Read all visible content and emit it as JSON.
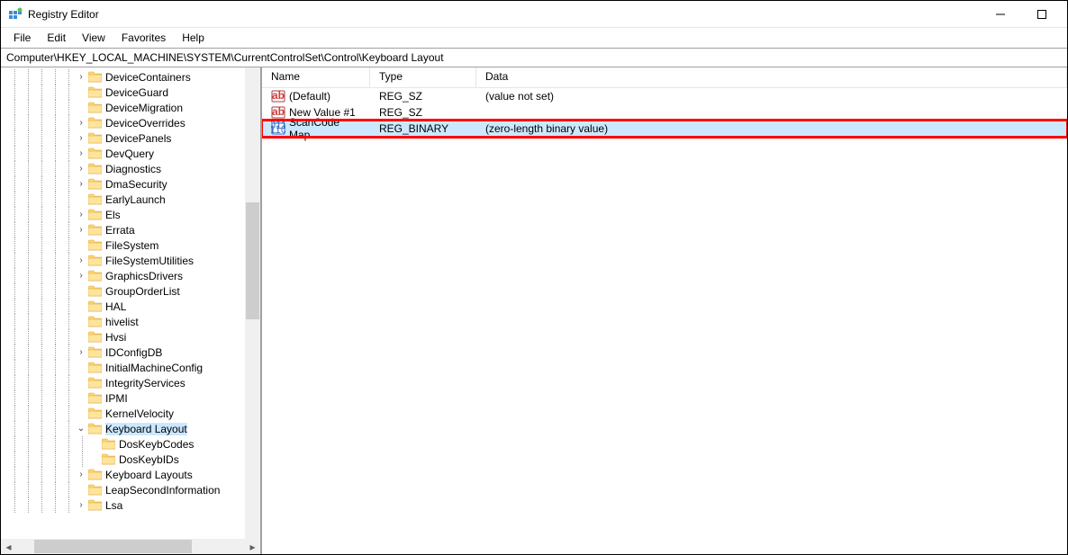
{
  "window": {
    "title": "Registry Editor"
  },
  "menubar": {
    "file": "File",
    "edit": "Edit",
    "view": "View",
    "favorites": "Favorites",
    "help": "Help"
  },
  "address_path": "Computer\\HKEY_LOCAL_MACHINE\\SYSTEM\\CurrentControlSet\\Control\\Keyboard Layout",
  "list": {
    "headers": {
      "name": "Name",
      "type": "Type",
      "data": "Data"
    },
    "rows": [
      {
        "icon": "string",
        "name": "(Default)",
        "type": "REG_SZ",
        "data": "(value not set)",
        "selected": false,
        "highlighted": false
      },
      {
        "icon": "string",
        "name": "New Value #1",
        "type": "REG_SZ",
        "data": "",
        "selected": false,
        "highlighted": false
      },
      {
        "icon": "binary",
        "name": "ScanCode Map",
        "type": "REG_BINARY",
        "data": "(zero-length binary value)",
        "selected": true,
        "highlighted": true
      }
    ]
  },
  "tree": {
    "items": [
      {
        "label": "DeviceContainers",
        "expandable": true,
        "depth": 5
      },
      {
        "label": "DeviceGuard",
        "expandable": false,
        "depth": 5
      },
      {
        "label": "DeviceMigration",
        "expandable": false,
        "depth": 5
      },
      {
        "label": "DeviceOverrides",
        "expandable": true,
        "depth": 5
      },
      {
        "label": "DevicePanels",
        "expandable": true,
        "depth": 5
      },
      {
        "label": "DevQuery",
        "expandable": true,
        "depth": 5
      },
      {
        "label": "Diagnostics",
        "expandable": true,
        "depth": 5
      },
      {
        "label": "DmaSecurity",
        "expandable": true,
        "depth": 5
      },
      {
        "label": "EarlyLaunch",
        "expandable": false,
        "depth": 5
      },
      {
        "label": "Els",
        "expandable": true,
        "depth": 5
      },
      {
        "label": "Errata",
        "expandable": true,
        "depth": 5
      },
      {
        "label": "FileSystem",
        "expandable": false,
        "depth": 5
      },
      {
        "label": "FileSystemUtilities",
        "expandable": true,
        "depth": 5
      },
      {
        "label": "GraphicsDrivers",
        "expandable": true,
        "depth": 5
      },
      {
        "label": "GroupOrderList",
        "expandable": false,
        "depth": 5
      },
      {
        "label": "HAL",
        "expandable": false,
        "depth": 5
      },
      {
        "label": "hivelist",
        "expandable": false,
        "depth": 5
      },
      {
        "label": "Hvsi",
        "expandable": false,
        "depth": 5
      },
      {
        "label": "IDConfigDB",
        "expandable": true,
        "depth": 5
      },
      {
        "label": "InitialMachineConfig",
        "expandable": false,
        "depth": 5
      },
      {
        "label": "IntegrityServices",
        "expandable": false,
        "depth": 5
      },
      {
        "label": "IPMI",
        "expandable": false,
        "depth": 5
      },
      {
        "label": "KernelVelocity",
        "expandable": false,
        "depth": 5
      },
      {
        "label": "Keyboard Layout",
        "expandable": true,
        "expanded": true,
        "selected": true,
        "depth": 5
      },
      {
        "label": "DosKeybCodes",
        "expandable": false,
        "depth": 6
      },
      {
        "label": "DosKeybIDs",
        "expandable": false,
        "depth": 6
      },
      {
        "label": "Keyboard Layouts",
        "expandable": true,
        "depth": 5
      },
      {
        "label": "LeapSecondInformation",
        "expandable": false,
        "depth": 5
      },
      {
        "label": "Lsa",
        "expandable": true,
        "depth": 5
      }
    ]
  }
}
